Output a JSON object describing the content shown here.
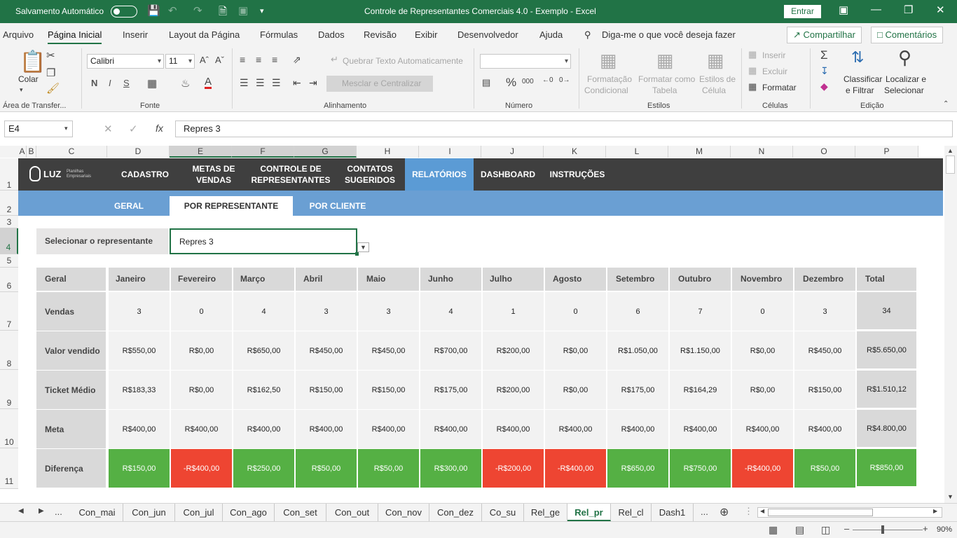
{
  "titlebar": {
    "autosave_label": "Salvamento Automático",
    "doc_title": "Controle de Representantes Comerciais 4.0 - Exemplo  -  Excel",
    "signin_label": "Entrar"
  },
  "menu": {
    "items": [
      "Arquivo",
      "Página Inicial",
      "Inserir",
      "Layout da Página",
      "Fórmulas",
      "Dados",
      "Revisão",
      "Exibir",
      "Desenvolvedor",
      "Ajuda"
    ],
    "tellme": "Diga-me o que você deseja fazer",
    "share": "Compartilhar",
    "comments": "Comentários"
  },
  "ribbon": {
    "paste": "Colar",
    "clipboard": "Área de Transfer...",
    "font_name": "Calibri",
    "font_size": "11",
    "font_group": "Fonte",
    "bold": "N",
    "italic": "I",
    "underline": "S",
    "wrap": "Quebrar Texto Automaticamente",
    "merge": "Mesclar e Centralizar",
    "align_group": "Alinhamento",
    "number_group": "Número",
    "cond_format_1": "Formatação",
    "cond_format_2": "Condicional",
    "fmt_table_1": "Formatar como",
    "fmt_table_2": "Tabela",
    "cell_styles_1": "Estilos de",
    "cell_styles_2": "Célula",
    "styles_group": "Estilos",
    "insert": "Inserir",
    "delete": "Excluir",
    "format": "Formatar",
    "cells_group": "Células",
    "sort_1": "Classificar",
    "sort_2": "e Filtrar",
    "find_1": "Localizar e",
    "find_2": "Selecionar",
    "edit_group": "Edição"
  },
  "formula_bar": {
    "name_box": "E4",
    "formula": "Repres 3"
  },
  "columns": [
    "A",
    "B",
    "C",
    "D",
    "E",
    "F",
    "G",
    "H",
    "I",
    "J",
    "K",
    "L",
    "M",
    "N",
    "O",
    "P"
  ],
  "rows": [
    "1",
    "2",
    "3",
    "4",
    "5",
    "6",
    "7",
    "8",
    "9",
    "10",
    "11"
  ],
  "nav": {
    "logo": "LUZ",
    "logo_sub_1": "Planilhas",
    "logo_sub_2": "Empresariais",
    "items": [
      {
        "l1": "CADASTRO",
        "l2": ""
      },
      {
        "l1": "METAS DE",
        "l2": "VENDAS"
      },
      {
        "l1": "CONTROLE DE",
        "l2": "REPRESENTANTES"
      },
      {
        "l1": "CONTATOS",
        "l2": "SUGERIDOS"
      },
      {
        "l1": "RELATÓRIOS",
        "l2": ""
      },
      {
        "l1": "DASHBOARD",
        "l2": ""
      },
      {
        "l1": "INSTRUÇÕES",
        "l2": ""
      }
    ],
    "subitems": [
      "GERAL",
      "POR REPRESENTANTE",
      "POR CLIENTE"
    ]
  },
  "selector": {
    "label": "Selecionar o representante",
    "value": "Repres 3"
  },
  "table": {
    "corner": "Geral",
    "months": [
      "Janeiro",
      "Fevereiro",
      "Março",
      "Abril",
      "Maio",
      "Junho",
      "Julho",
      "Agosto",
      "Setembro",
      "Outubro",
      "Novembro",
      "Dezembro"
    ],
    "total_label": "Total",
    "rows": [
      {
        "label": "Vendas",
        "values": [
          "3",
          "0",
          "4",
          "3",
          "3",
          "4",
          "1",
          "0",
          "6",
          "7",
          "0",
          "3"
        ],
        "total": "34"
      },
      {
        "label": "Valor vendido",
        "values": [
          "R$550,00",
          "R$0,00",
          "R$650,00",
          "R$450,00",
          "R$450,00",
          "R$700,00",
          "R$200,00",
          "R$0,00",
          "R$1.050,00",
          "R$1.150,00",
          "R$0,00",
          "R$450,00"
        ],
        "total": "R$5.650,00"
      },
      {
        "label": "Ticket Médio",
        "values": [
          "R$183,33",
          "R$0,00",
          "R$162,50",
          "R$150,00",
          "R$150,00",
          "R$175,00",
          "R$200,00",
          "R$0,00",
          "R$175,00",
          "R$164,29",
          "R$0,00",
          "R$150,00"
        ],
        "total": "R$1.510,12"
      },
      {
        "label": "Meta",
        "values": [
          "R$400,00",
          "R$400,00",
          "R$400,00",
          "R$400,00",
          "R$400,00",
          "R$400,00",
          "R$400,00",
          "R$400,00",
          "R$400,00",
          "R$400,00",
          "R$400,00",
          "R$400,00"
        ],
        "total": "R$4.800,00"
      },
      {
        "label": "Diferença",
        "values": [
          "R$150,00",
          "-R$400,00",
          "R$250,00",
          "R$50,00",
          "R$50,00",
          "R$300,00",
          "-R$200,00",
          "-R$400,00",
          "R$650,00",
          "R$750,00",
          "-R$400,00",
          "R$50,00"
        ],
        "total": "R$850,00"
      }
    ]
  },
  "tabs": {
    "ellipsis": "...",
    "items": [
      "Con_mai",
      "Con_jun",
      "Con_jul",
      "Con_ago",
      "Con_set",
      "Con_out",
      "Con_nov",
      "Con_dez",
      "Co_su",
      "Rel_ge",
      "Rel_pr",
      "Rel_cl",
      "Dash1"
    ],
    "active": "Rel_pr"
  },
  "status": {
    "zoom": "90%"
  },
  "colors": {
    "excel_green": "#217346",
    "nav_dark": "#3f3f3f",
    "nav_active": "#5b9bd5",
    "positive": "#55b044",
    "negative": "#ee4532"
  }
}
